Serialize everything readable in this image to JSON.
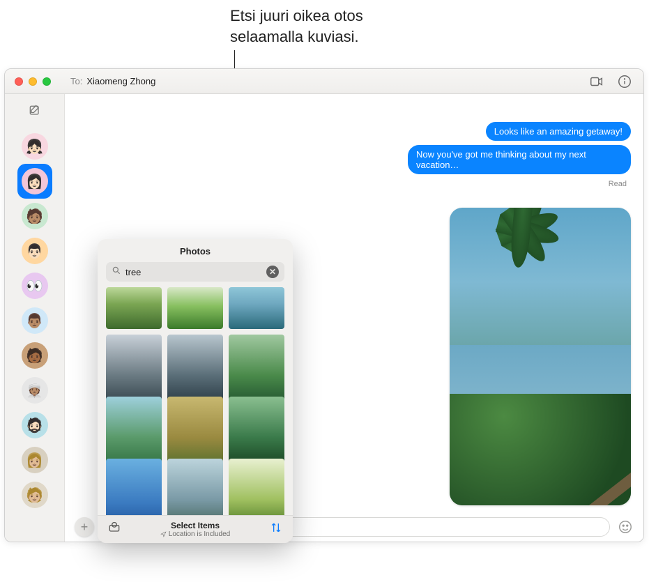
{
  "callout": {
    "line1": "Etsi juuri oikea otos",
    "line2": "selaamalla kuviasi."
  },
  "titlebar": {
    "to_label": "To:",
    "to_name": "Xiaomeng Zhong"
  },
  "sidebar": {
    "contacts": [
      {
        "bg": "#f8d7e0",
        "emoji": "👧🏻"
      },
      {
        "bg": "#f2c6d8",
        "emoji": "👩🏻",
        "selected": true
      },
      {
        "bg": "#c8e8d0",
        "emoji": "🧑🏽"
      },
      {
        "bg": "#ffd7a0",
        "emoji": "👨🏻"
      },
      {
        "bg": "#e8c8f0",
        "emoji": "👀"
      },
      {
        "bg": "#d0e8f8",
        "emoji": "👨🏽"
      },
      {
        "bg": "#c8a078",
        "emoji": "🧑🏾"
      },
      {
        "bg": "#e6e6e6",
        "emoji": "👳🏽"
      },
      {
        "bg": "#b8e0e8",
        "emoji": "🧔🏻"
      },
      {
        "bg": "#d8d0c0",
        "emoji": "👩🏼"
      },
      {
        "bg": "#e0d8c8",
        "emoji": "🧑🏼"
      }
    ]
  },
  "conversation": {
    "msg1": "Looks like an amazing getaway!",
    "msg2": "Now you've got me thinking about my next vacation…",
    "read": "Read"
  },
  "photos_popover": {
    "title": "Photos",
    "search_value": "tree",
    "footer_title": "Select Items",
    "footer_sub": "Location is Included",
    "thumbs": [
      {
        "cls": "wide",
        "style": "background:linear-gradient(#bcd89a 0%,#7ba653 40%,#3e6a2d 100%)"
      },
      {
        "cls": "wide",
        "style": "background:linear-gradient(#d8e8c8 0%,#88c060 45%,#3a7a2a 100%)"
      },
      {
        "cls": "wide",
        "style": "background:linear-gradient(#8ec6d8 0%,#6fa8c0 40%,#2a6a7a 100%)"
      },
      {
        "cls": "",
        "style": "background:linear-gradient(#c8d0d8 0%,#6a7a82 55%,#2a3a42 100%)"
      },
      {
        "cls": "",
        "style": "background:linear-gradient(#b8c6ce 0%,#5a6e78 55%,#20303a 100%)"
      },
      {
        "cls": "",
        "style": "background:linear-gradient(#a0c8a0 0%,#4a8a4a 55%,#1a4a2a 100%)"
      },
      {
        "cls": "",
        "style": "background:linear-gradient(#9ed0dc 0%,#5a9a6a 55%,#2a6a3a 100%)"
      },
      {
        "cls": "",
        "style": "background:linear-gradient(#c8b870 0%,#9a8a40 55%,#4a6a2a 100%)"
      },
      {
        "cls": "",
        "style": "background:linear-gradient(#8abf90 0%,#3a7a4a 55%,#123a1a 100%)"
      },
      {
        "cls": "",
        "style": "background:linear-gradient(#6ab0e0 0%,#3a7ac0 60%,#1a4a90 100%)"
      },
      {
        "cls": "",
        "style": "background:linear-gradient(#bcd4dc 0%,#7a9aa6 55%,#3a5a4a 100%)"
      },
      {
        "cls": "",
        "style": "background:linear-gradient(#e8f0d0 0%,#a0c060 55%,#3a6a1a 100%)"
      }
    ]
  }
}
